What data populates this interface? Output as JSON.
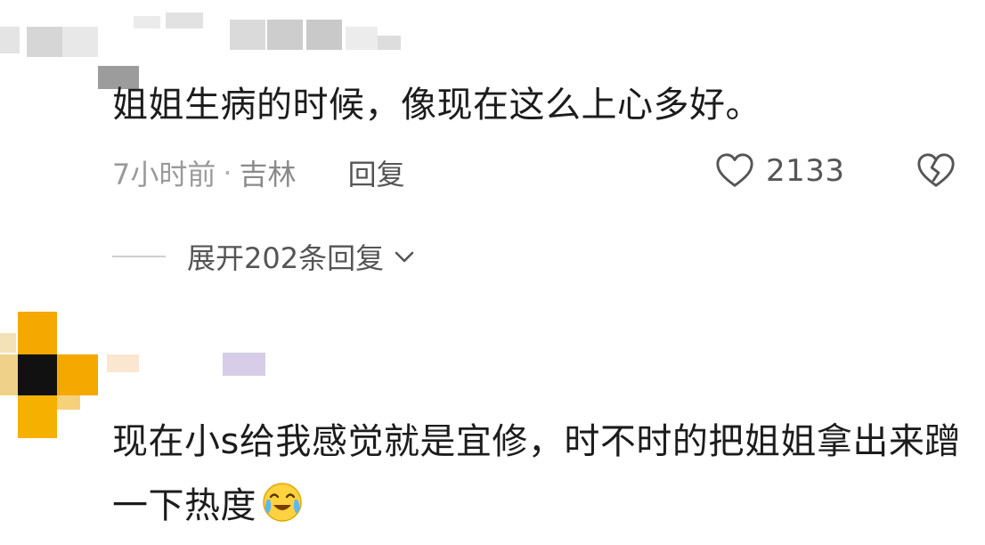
{
  "comments": [
    {
      "text": "姐姐生病的时候，像现在这么上心多好。",
      "time": "7小时前",
      "separator": "·",
      "location": "吉林",
      "reply_label": "回复",
      "like_count": "2133",
      "expand_label": "展开202条回复"
    },
    {
      "text": "现在小s给我感觉就是宜修，时不时的把姐姐拿出来蹭一下热度",
      "emoji": "crying-laughing-emoji"
    }
  ],
  "icons": {
    "like": "heart-outline-icon",
    "dislike": "broken-heart-icon",
    "expand": "chevron-down-icon"
  },
  "colors": {
    "text": "#1c1c1c",
    "meta": "#8a8a8a",
    "secondary": "#555555",
    "avatar_orange": "#f5a800",
    "avatar_black": "#111111"
  }
}
